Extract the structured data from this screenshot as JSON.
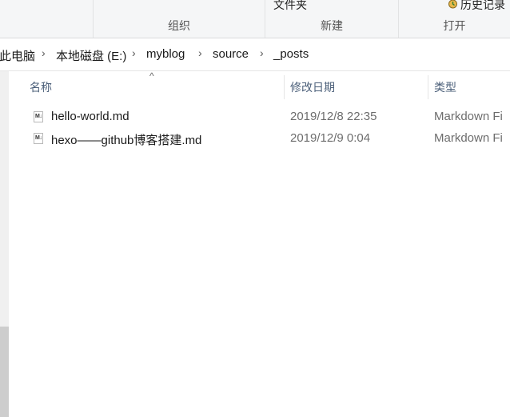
{
  "ribbon": {
    "groups": [
      {
        "title": "组织"
      },
      {
        "title": "新建",
        "partial_button": "文件夹"
      },
      {
        "title": "打开",
        "partial_button": "历史记录"
      }
    ]
  },
  "address": {
    "crumbs": [
      "此电脑",
      "本地磁盘 (E:)",
      "myblog",
      "source",
      "_posts"
    ]
  },
  "columns": {
    "name": "名称",
    "date": "修改日期",
    "type": "类型"
  },
  "files": [
    {
      "name": "hello-world.md",
      "date": "2019/12/8 22:35",
      "type": "Markdown Fi",
      "icon": "markdown-file-icon"
    },
    {
      "name": "hexo——github博客搭建.md",
      "date": "2019/12/9 0:04",
      "type": "Markdown Fi",
      "icon": "markdown-file-icon"
    }
  ],
  "colors": {
    "header_text": "#4c607a",
    "ribbon_bg": "#f5f6f7"
  }
}
